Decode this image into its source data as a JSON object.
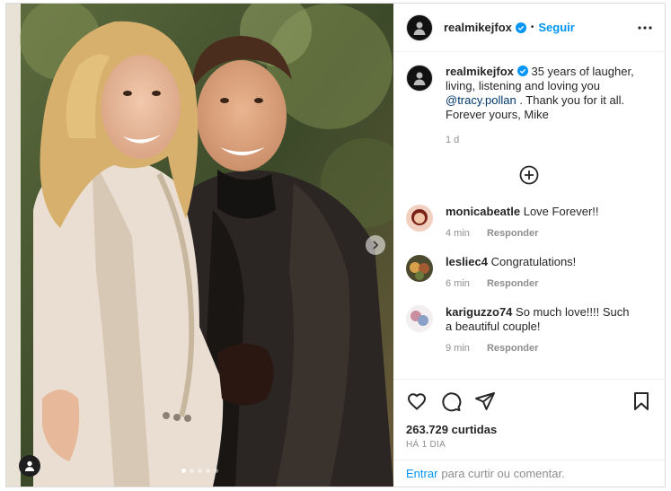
{
  "post": {
    "username": "realmikejfox",
    "follow_label": "Seguir",
    "separator": "•",
    "caption_username": "realmikejfox",
    "caption_text_1": " 35 years of laugher, living, listening and loving you ",
    "caption_mention": "@tracy.pollan",
    "caption_text_2": " . Thank you for it all. Forever yours, Mike",
    "caption_age": "1 d"
  },
  "comments": [
    {
      "username": "monicabeatle",
      "text": "Love Forever!!",
      "age": "4 min",
      "reply": "Responder",
      "avatar_color": "#b8493a"
    },
    {
      "username": "lesliec4",
      "text": "Congratulations!",
      "age": "6 min",
      "reply": "Responder",
      "avatar_color": "#6a5d2e"
    },
    {
      "username": "kariguzzo74",
      "text": "So much love!!!! Such a beautiful couple!",
      "age": "9 min",
      "reply": "Responder",
      "avatar_color": "#c9a9b0"
    }
  ],
  "engagement": {
    "likes": "263.729 curtidas",
    "date": "HÁ 1 DIA"
  },
  "login": {
    "link": "Entrar",
    "text": "para curtir ou comentar."
  },
  "carousel": {
    "dot_count": 5,
    "active_index": 0
  },
  "icons": [
    "heart-icon",
    "comment-icon",
    "share-icon",
    "bookmark-icon",
    "more-options-icon",
    "add-circle-icon",
    "verified-icon",
    "chevron-right-icon",
    "user-tag-icon"
  ],
  "colors": {
    "accent": "#0095f6",
    "verified": "#0095f6",
    "text": "#262626",
    "muted": "#8e8e8e",
    "mention": "#00376b"
  }
}
